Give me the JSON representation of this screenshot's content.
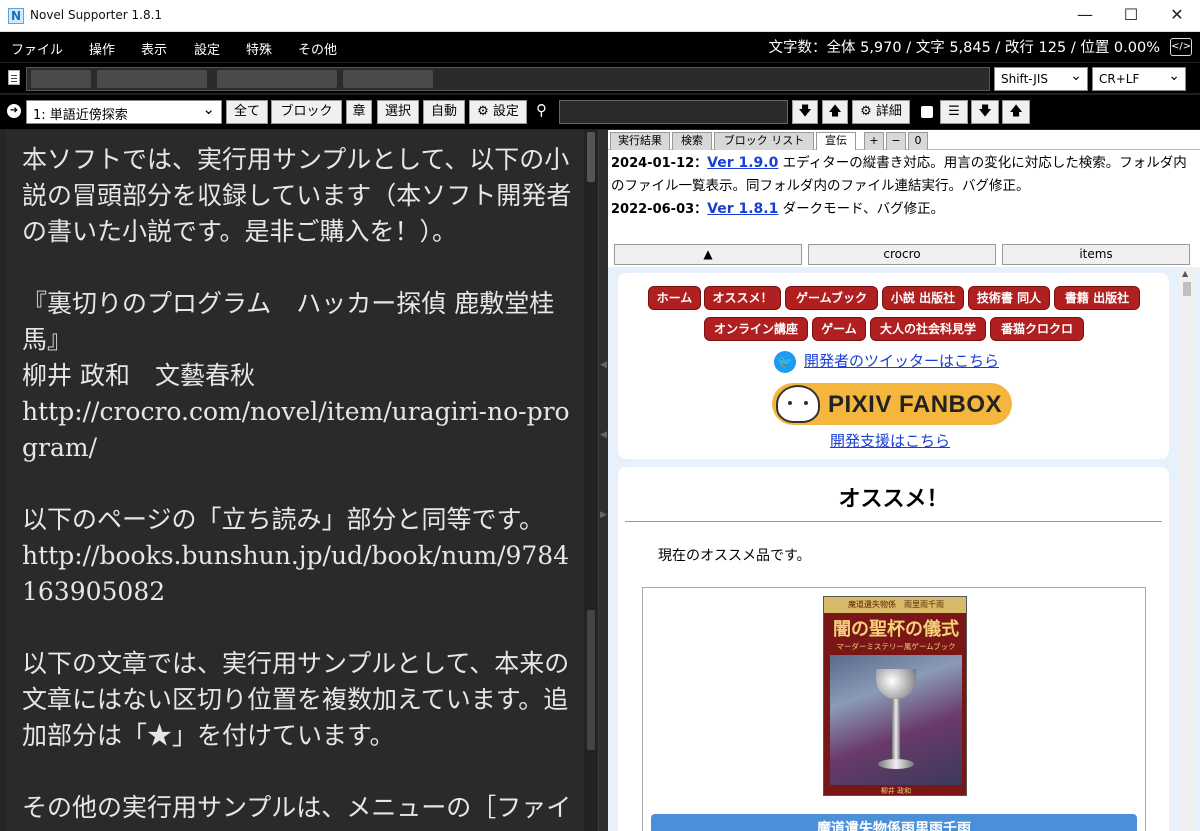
{
  "window": {
    "title": "Novel Supporter 1.8.1",
    "icon_letter": "N"
  },
  "menu": {
    "items": [
      "ファイル",
      "操作",
      "表示",
      "設定",
      "特殊",
      "その他"
    ],
    "stats": "文字数：全体 5,970 / 文字 5,845 / 改行 125 / 位置 0.00%",
    "code_button": "</>"
  },
  "file": {
    "encoding": "Shift-JIS",
    "line_ending": "CR+LF"
  },
  "toolbar": {
    "mode": "1: 単語近傍探索",
    "all": "全て",
    "block": "ブロック",
    "chapter": "章",
    "select": "選択",
    "auto": "自動",
    "settings": "⚙ 設定",
    "detail": "⚙ 詳細"
  },
  "editor": {
    "text": "本ソフトでは、実行用サンプルとして、以下の小説の冒頭部分を収録しています（本ソフト開発者の書いた小説です。是非ご購入を！）。\n\n『裏切りのプログラム　ハッカー探偵 鹿敷堂桂馬』\n柳井 政和　文藝春秋\nhttp://crocro.com/novel/item/uragiri-no-program/\n\n以下のページの「立ち読み」部分と同等です。\nhttp://books.bunshun.jp/ud/book/num/9784163905082\n\n以下の文章では、実行用サンプルとして、本来の文章にはない区切り位置を複数加えています。追加部分は「★」を付けています。\n\nその他の実行用サンプルは、メニューの［ファイ"
  },
  "panel": {
    "tabs": [
      "実行結果",
      "検索",
      "ブロック リスト",
      "宣伝",
      "+",
      "−",
      "0"
    ],
    "news": [
      {
        "date": "2024-01-12：",
        "version": "Ver 1.9.0",
        "desc": " エディターの縦書き対応。用言の変化に対応した検索。フォルダ内のファイル一覧表示。同フォルダ内のファイル連結実行。バグ修正。"
      },
      {
        "date": "2022-06-03：",
        "version": "Ver 1.8.1",
        "desc": " ダークモード、バグ修正。"
      }
    ],
    "nav": [
      "▲",
      "crocro",
      "items"
    ]
  },
  "browser": {
    "pills_row1": [
      "ホーム",
      "オススメ！",
      "ゲームブック",
      "小説 出版社",
      "技術書 同人",
      "書籍 出版社"
    ],
    "pills_row2": [
      "オンライン講座",
      "ゲーム",
      "大人の社会科見学",
      "番猫クロクロ"
    ],
    "twitter_link": "開発者のツイッターはこちら",
    "fanbox_text": "PIXIV FANBOX",
    "fanbox_link": "開発支援はこちら",
    "recommend_title": "オススメ！",
    "recommend_intro": "現在のオススメ品です。",
    "cover_top": "魔道遺失物係　雨里雨千雨",
    "cover_title": "闇の聖杯の儀式",
    "cover_sub": "マーダーミステリー風ゲームブック",
    "cover_author": "柳井 政和",
    "product_button": "魔道遺失物係雨里雨千雨"
  },
  "colors": {
    "accent_red": "#b02020",
    "link_blue": "#1a3fd6",
    "editor_bg": "#2a2a2a"
  }
}
